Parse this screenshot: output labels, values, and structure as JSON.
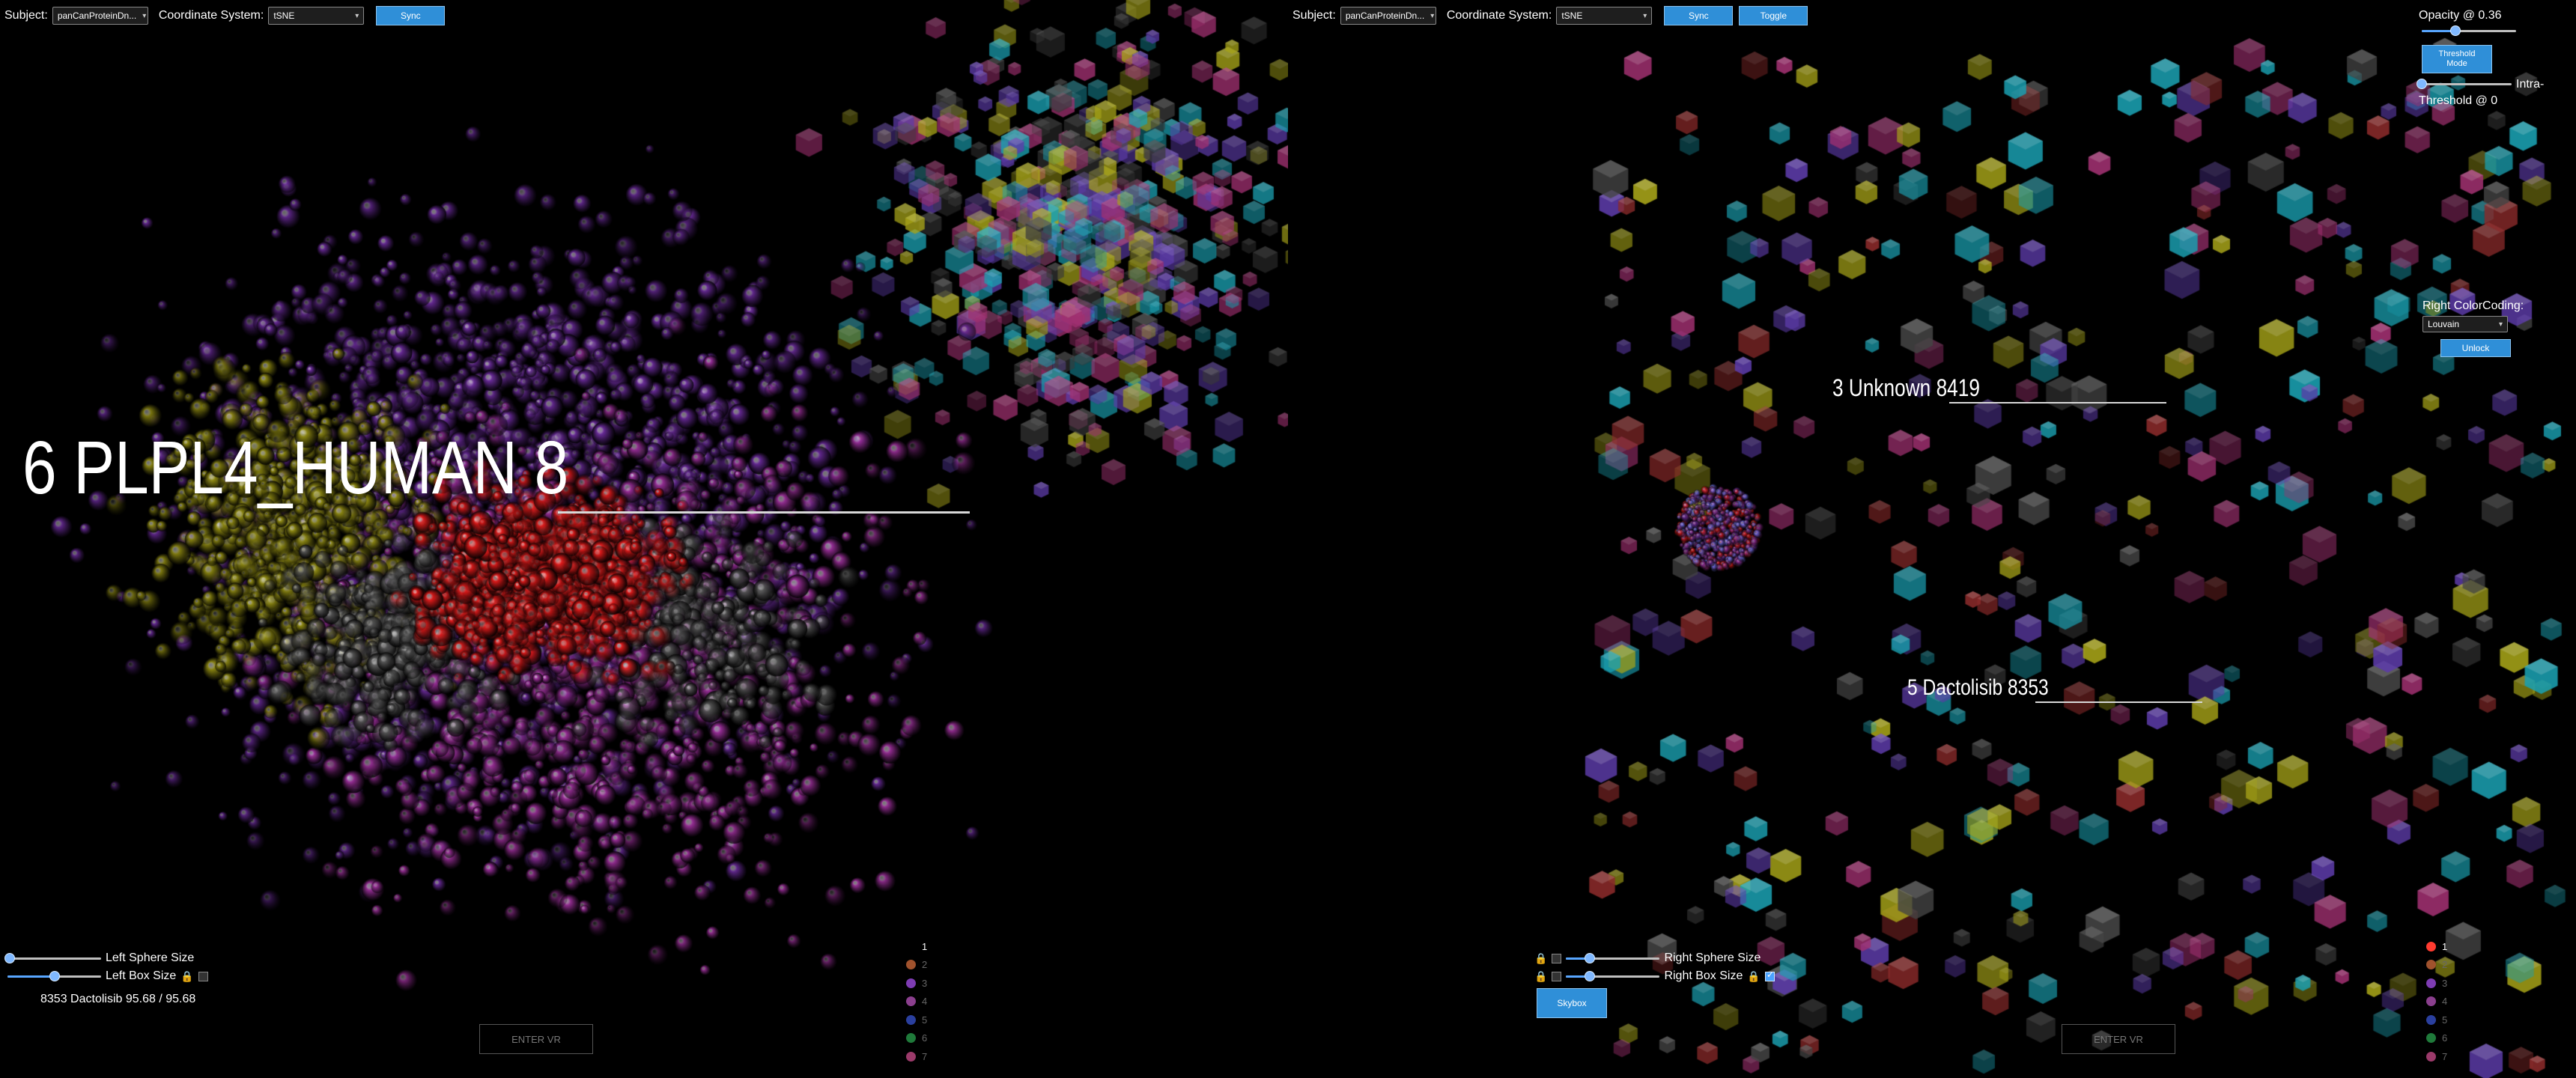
{
  "left": {
    "toolbar": {
      "subject_label": "Subject:",
      "subject_value": "panCanProteinDn...",
      "coord_label": "Coordinate System:",
      "coord_value": "tSNE",
      "sync_label": "Sync"
    },
    "big_label": "6 PLPL4_HUMAN 8",
    "sphere_size_label": "Left Sphere Size",
    "box_size_label": "Left Box Size",
    "box_size_checked": false,
    "sphere_size_level": 0.02,
    "box_size_level": 0.5,
    "info_text": "8353 Dactolisib 95.68 / 95.68",
    "enter_vr_label": "ENTER VR",
    "legend": [
      {
        "label": "1",
        "color": "#000000"
      },
      {
        "label": "2",
        "color": "#a0522d"
      },
      {
        "label": "3",
        "color": "#7e3cb3"
      },
      {
        "label": "4",
        "color": "#8b3f8e"
      },
      {
        "label": "5",
        "color": "#2a3f9e"
      },
      {
        "label": "6",
        "color": "#1f7a3a"
      },
      {
        "label": "7",
        "color": "#9b3a6a"
      }
    ]
  },
  "right": {
    "toolbar": {
      "subject_label": "Subject:",
      "subject_value": "panCanProteinDn...",
      "coord_label": "Coordinate System:",
      "coord_value": "tSNE",
      "sync_label": "Sync",
      "toggle_label": "Toggle"
    },
    "label_a": "3 Unknown 8419",
    "label_b": "5 Dactolisib 8353",
    "sphere_size_label": "Right Sphere Size",
    "box_size_label": "Right Box Size",
    "box_size_checked": true,
    "sphere_size_level": 0.25,
    "box_size_level": 0.25,
    "skybox_label": "Skybox",
    "enter_vr_label": "ENTER VR",
    "legend": [
      {
        "label": "1",
        "color": "#ff3b30"
      },
      {
        "label": "2",
        "color": "#a0522d"
      },
      {
        "label": "3",
        "color": "#7e3cb3"
      },
      {
        "label": "4",
        "color": "#8b3f8e"
      },
      {
        "label": "5",
        "color": "#2a3f9e"
      },
      {
        "label": "6",
        "color": "#1f7a3a"
      },
      {
        "label": "7",
        "color": "#9b3a6a"
      }
    ]
  },
  "panel": {
    "opacity_label": "Opacity @ 0.36",
    "opacity_level": 0.36,
    "threshold_mode_label": "Threshold Mode",
    "intra_label": "Intra-",
    "threshold_label": "Threshold @ 0",
    "threshold_level": 0.0,
    "color_coding_label": "Right ColorCoding:",
    "color_coding_value": "Louvain",
    "unlock_label": "Unlock"
  },
  "colors": {
    "accent": "#2f8fd8",
    "sphere_red": "#e21a1a",
    "sphere_yellow": "#8f8a12",
    "sphere_purple": "#6a2b9a",
    "sphere_magenta": "#9c2f9a",
    "box_cyan": "#1a9fb0",
    "box_yellow": "#a6a318"
  }
}
